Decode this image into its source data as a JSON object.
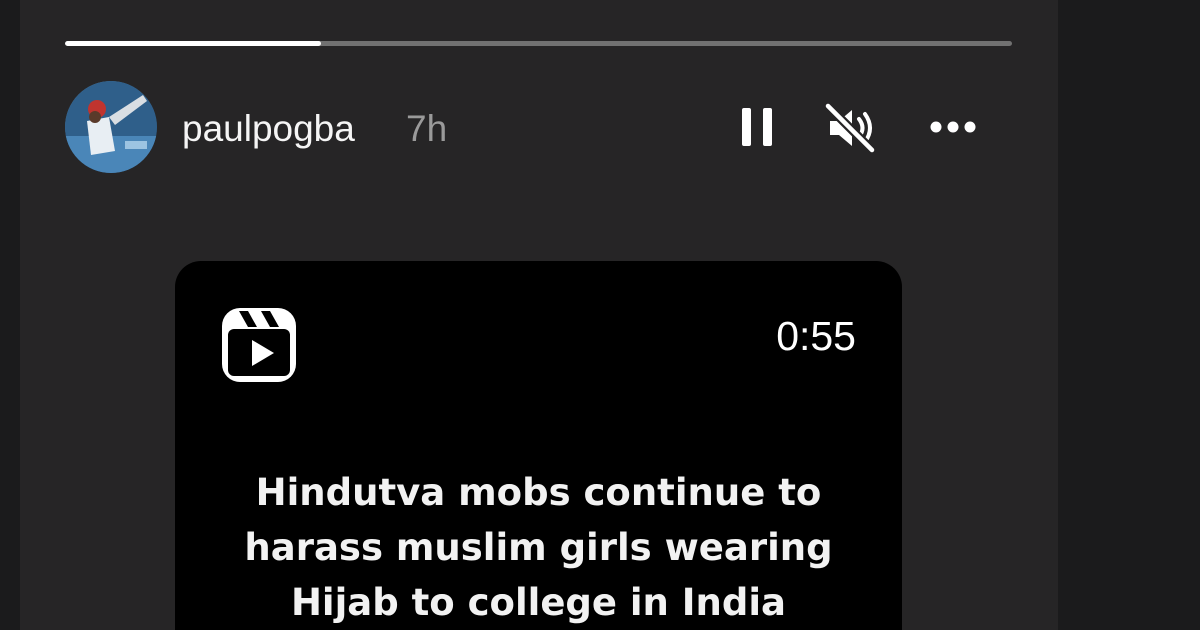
{
  "story": {
    "username": "paulpogba",
    "timestamp": "7h",
    "progress": 0.27,
    "controls": {
      "pause_icon": "pause-icon",
      "mute_icon": "speaker-muted-icon",
      "more_icon": "more-horizontal-icon"
    }
  },
  "reel": {
    "icon": "reels-icon",
    "duration": "0:55",
    "caption": "Hindutva mobs continue to\nharass muslim girls wearing\nHijab to college in India"
  },
  "colors": {
    "panel_background": "#262526",
    "card_background": "#000000",
    "text_primary": "#f5f5f5",
    "text_secondary": "#9a9a9a"
  }
}
